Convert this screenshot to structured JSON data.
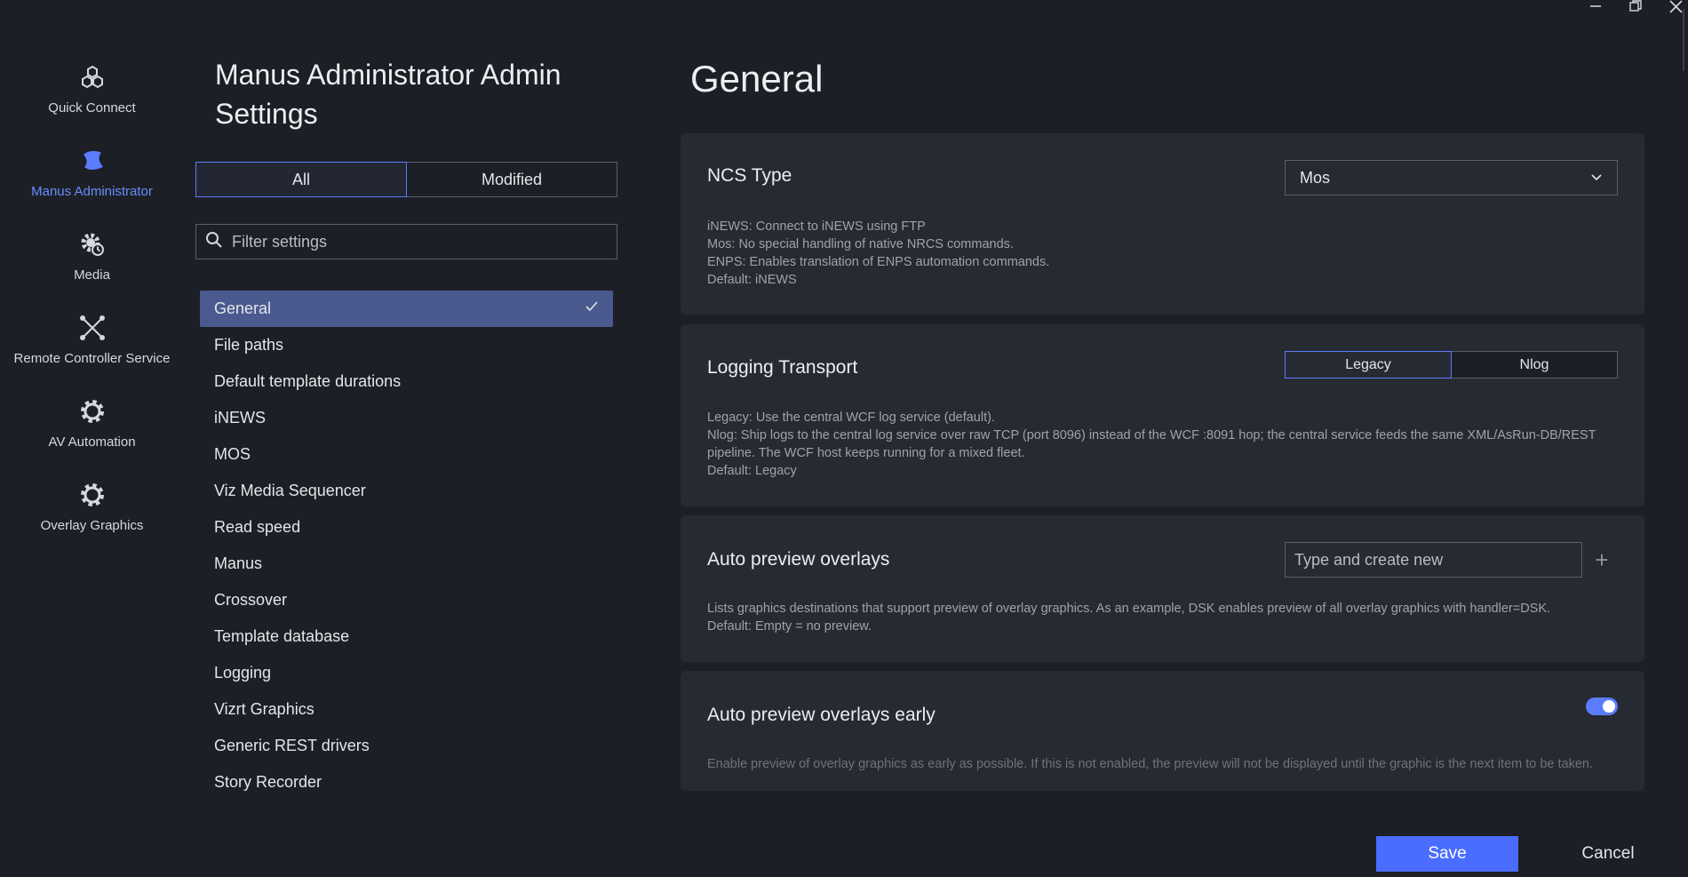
{
  "window": {
    "min": "—",
    "close": "✕"
  },
  "nav": [
    {
      "label": "Quick Connect",
      "icon": "quick-connect-icon"
    },
    {
      "label": "Manus Administrator",
      "icon": "manus-administrator-icon",
      "active": true
    },
    {
      "label": "Media",
      "icon": "media-gear-icon"
    },
    {
      "label": "Remote Controller Service",
      "icon": "remote-controller-icon"
    },
    {
      "label": "AV Automation",
      "icon": "av-automation-gear-icon"
    },
    {
      "label": "Overlay Graphics",
      "icon": "overlay-graphics-gear-icon"
    }
  ],
  "settings": {
    "title": "Manus Administrator Admin Settings",
    "filter_tabs": {
      "all": "All",
      "modified": "Modified"
    },
    "filter_placeholder": "Filter settings",
    "categories": [
      "General",
      "File paths",
      "Default template durations",
      "iNEWS",
      "MOS",
      "Viz Media Sequencer",
      "Read speed",
      "Manus",
      "Crossover",
      "Template database",
      "Logging",
      "Vizrt Graphics",
      "Generic REST drivers",
      "Story Recorder"
    ],
    "active_category": "General"
  },
  "main": {
    "title": "General",
    "ncs": {
      "title": "NCS Type",
      "value": "Mos",
      "desc": [
        "iNEWS: Connect to iNEWS using FTP",
        "Mos: No special handling of native NRCS commands.",
        "ENPS: Enables translation of ENPS automation commands.",
        "Default: iNEWS"
      ]
    },
    "logging": {
      "title": "Logging Transport",
      "options": [
        "Legacy",
        "Nlog"
      ],
      "selected": "Legacy",
      "desc": [
        "Legacy: Use the central WCF log service (default).",
        "Nlog: Ship logs to the central log service over raw TCP (port 8096) instead of the WCF :8091 hop; the central service feeds the same XML/AsRun-DB/REST pipeline. The WCF host keeps running for a mixed fleet.",
        "Default: Legacy"
      ]
    },
    "preview": {
      "title": "Auto preview overlays",
      "placeholder": "Type and create new",
      "desc": [
        "Lists graphics destinations that support preview of overlay graphics. As an example, DSK enables preview of all overlay graphics with handler=DSK.",
        "Default: Empty = no preview."
      ]
    },
    "preview_early": {
      "title": "Auto preview overlays early",
      "enabled": true,
      "desc": "Enable preview of overlay graphics as early as possible. If this is not enabled, the preview will not be displayed until the graphic is the next item to be taken."
    }
  },
  "footer": {
    "save": "Save",
    "cancel": "Cancel"
  },
  "colors": {
    "accent": "#5b7cff",
    "active_item": "#4a5a8e",
    "bg": "#1c1f25",
    "card": "#262a31"
  }
}
